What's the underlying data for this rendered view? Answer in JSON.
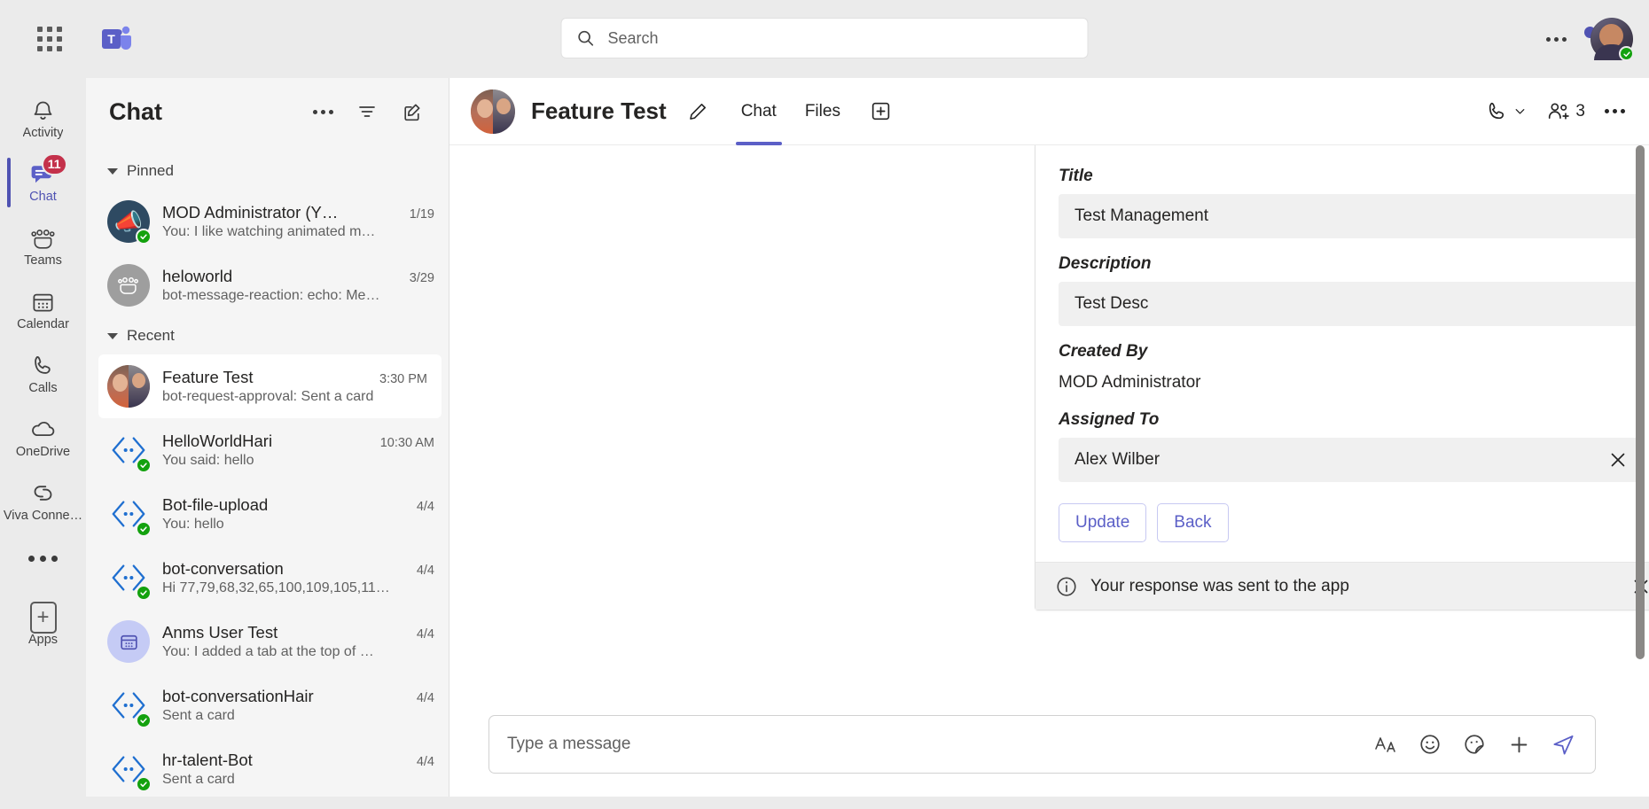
{
  "app": {
    "product": "Microsoft Teams",
    "logo_icon": "teams-logo-icon",
    "waffle_icon": "app-launcher-icon"
  },
  "topbar": {
    "search": {
      "placeholder": "Search",
      "value": "",
      "icon": "search-icon"
    },
    "more_label": "…",
    "more_icon": "more-options-icon",
    "avatar": {
      "name": "MOD Administrator",
      "presence": "Available",
      "icon": "user-avatar"
    },
    "notification_dot": true
  },
  "rail": {
    "items": [
      {
        "label": "Activity",
        "icon": "bell-icon",
        "active": false,
        "badge": ""
      },
      {
        "label": "Chat",
        "icon": "chat-bubble-icon",
        "active": true,
        "badge": "11"
      },
      {
        "label": "Teams",
        "icon": "teams-people-icon",
        "active": false,
        "badge": ""
      },
      {
        "label": "Calendar",
        "icon": "calendar-icon",
        "active": false,
        "badge": ""
      },
      {
        "label": "Calls",
        "icon": "phone-icon",
        "active": false,
        "badge": ""
      },
      {
        "label": "OneDrive",
        "icon": "cloud-icon",
        "active": false,
        "badge": ""
      },
      {
        "label": "Viva Conne…",
        "icon": "viva-connections-icon",
        "active": false,
        "badge": ""
      }
    ],
    "more_icon": "more-apps-icon",
    "apps": {
      "label": "Apps",
      "icon": "apps-plus-icon"
    }
  },
  "chatlist": {
    "title": "Chat",
    "more_icon": "chat-more-options-icon",
    "filter_icon": "filter-icon",
    "compose_icon": "new-chat-icon",
    "groups": [
      {
        "name": "Pinned",
        "expanded": true,
        "items": [
          {
            "name": "MOD Administrator (Y…",
            "time": "1/19",
            "preview": "You: I like watching animated m…",
            "avatar": "megaphone",
            "presence": "available",
            "selected": false
          },
          {
            "name": "heloworld",
            "time": "3/29",
            "preview": "bot-message-reaction: echo: Me…",
            "avatar": "group",
            "presence": "none",
            "selected": false
          }
        ]
      },
      {
        "name": "Recent",
        "expanded": true,
        "items": [
          {
            "name": "Feature Test",
            "time": "3:30 PM",
            "preview": "bot-request-approval: Sent a card",
            "avatar": "photo",
            "presence": "none",
            "selected": true
          },
          {
            "name": "HelloWorldHari",
            "time": "10:30 AM",
            "preview": "You said: hello",
            "avatar": "code",
            "presence": "available",
            "selected": false
          },
          {
            "name": "Bot-file-upload",
            "time": "4/4",
            "preview": "You: hello",
            "avatar": "code",
            "presence": "available",
            "selected": false
          },
          {
            "name": "bot-conversation",
            "time": "4/4",
            "preview": "Hi 77,79,68,32,65,100,109,105,11…",
            "avatar": "code",
            "presence": "available",
            "selected": false
          },
          {
            "name": "Anms User Test",
            "time": "4/4",
            "preview": "You: I added a tab at the top of …",
            "avatar": "calendar",
            "presence": "none",
            "selected": false
          },
          {
            "name": "bot-conversationHair",
            "time": "4/4",
            "preview": "Sent a card",
            "avatar": "code",
            "presence": "available",
            "selected": false
          },
          {
            "name": "hr-talent-Bot",
            "time": "4/4",
            "preview": "Sent a card",
            "avatar": "code",
            "presence": "available",
            "selected": false
          }
        ]
      }
    ]
  },
  "conversation": {
    "title": "Feature Test",
    "edit_icon": "pencil-icon",
    "tabs": [
      {
        "label": "Chat",
        "active": true
      },
      {
        "label": "Files",
        "active": false
      }
    ],
    "add_tab_icon": "add-tab-icon",
    "call_icon": "call-icon",
    "call_chevron_icon": "chevron-down-icon",
    "participants_icon": "people-add-icon",
    "participants_count": "3",
    "more_icon": "conversation-more-options-icon"
  },
  "card": {
    "fields": [
      {
        "label": "Title",
        "type": "input",
        "value": "Test Management",
        "clearable": false
      },
      {
        "label": "Description",
        "type": "input",
        "value": "Test Desc",
        "clearable": false
      },
      {
        "label": "Created By",
        "type": "static",
        "value": "MOD Administrator",
        "clearable": false
      },
      {
        "label": "Assigned To",
        "type": "input",
        "value": "Alex Wilber",
        "clearable": true
      }
    ],
    "buttons": [
      {
        "label": "Update",
        "name": "update-button"
      },
      {
        "label": "Back",
        "name": "back-button"
      }
    ],
    "notice": {
      "text": "Your response was sent to the app",
      "info_icon": "info-icon",
      "close_icon": "close-icon"
    }
  },
  "compose": {
    "placeholder": "Type a message",
    "value": "",
    "tools": [
      {
        "name": "format-icon",
        "title": "Format"
      },
      {
        "name": "emoji-icon",
        "title": "Emoji"
      },
      {
        "name": "sticker-icon",
        "title": "Sticker"
      },
      {
        "name": "add-attachment-icon",
        "title": "More"
      },
      {
        "name": "send-icon",
        "title": "Send"
      }
    ]
  },
  "colors": {
    "accent": "#5b5fc7",
    "rail_active": "#4f52b2",
    "badge": "#c4314b",
    "presence_available": "#13a10e",
    "chrome": "#ebebeb",
    "panel": "#f5f5f5"
  }
}
